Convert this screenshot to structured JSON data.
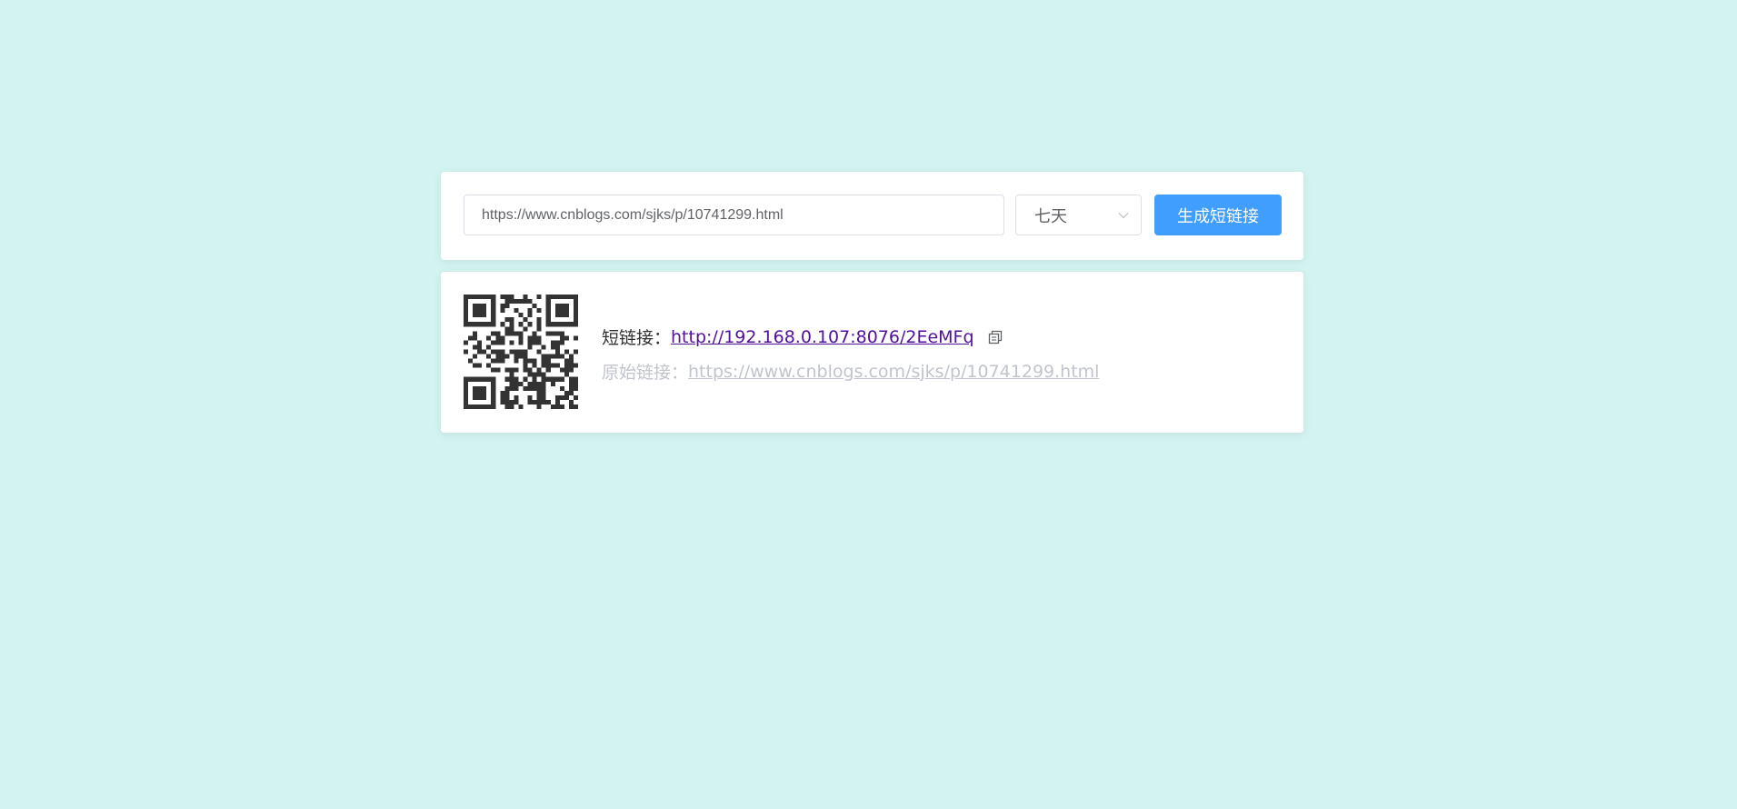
{
  "form": {
    "url_value": "https://www.cnblogs.com/sjks/p/10741299.html",
    "expiry_selected": "七天",
    "generate_label": "生成短链接"
  },
  "result": {
    "short_label": "短链接：",
    "short_url": "http://192.168.0.107:8076/2EeMFq",
    "original_label": "原始链接：",
    "original_url": "https://www.cnblogs.com/sjks/p/10741299.html",
    "qr_icon": "qr-code",
    "copy_icon": "copy-icon"
  },
  "colors": {
    "background": "#d3f3f0",
    "primary": "#409eff",
    "short_link": "#52119b",
    "muted": "#c0c4cc"
  }
}
